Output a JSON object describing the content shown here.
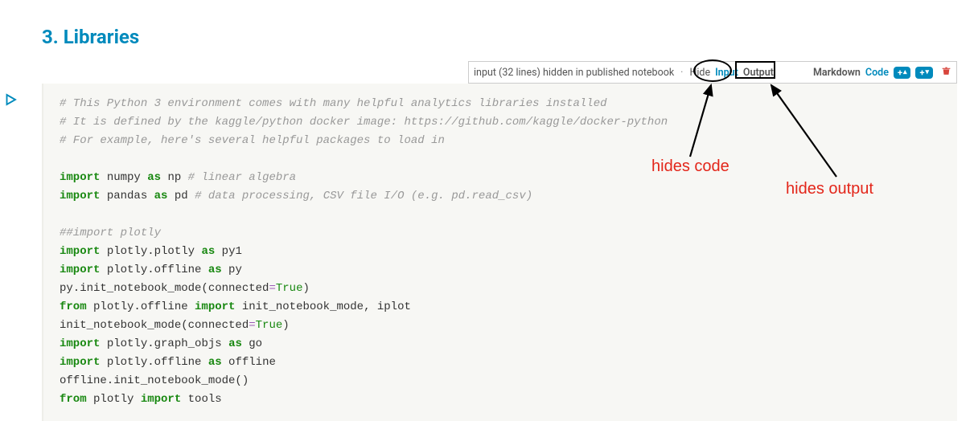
{
  "heading": "3. Libraries",
  "toolbar": {
    "status": "input (32 lines) hidden in published notebook",
    "hide_label": "Hide",
    "input_label": "Input",
    "output_label": "Output",
    "markdown_label": "Markdown",
    "code_label": "Code",
    "add_above": "+",
    "add_below": "+"
  },
  "annotations": {
    "hides_code": "hides code",
    "hides_output": "hides output"
  },
  "code": {
    "l1": "# This Python 3 environment comes with many helpful analytics libraries installed",
    "l2": "# It is defined by the kaggle/python docker image: https://github.com/kaggle/docker-python",
    "l3": "# For example, here's several helpful packages to load in",
    "l4_kw1": "import",
    "l4_txt1": " numpy ",
    "l4_kw2": "as",
    "l4_txt2": " np ",
    "l4_cm": "# linear algebra",
    "l5_kw1": "import",
    "l5_txt1": " pandas ",
    "l5_kw2": "as",
    "l5_txt2": " pd ",
    "l5_cm": "# data processing, CSV file I/O (e.g. pd.read_csv)",
    "l6": "##import plotly",
    "l7_kw1": "import",
    "l7_txt1": " plotly.plotly ",
    "l7_kw2": "as",
    "l7_txt2": " py1",
    "l8_kw1": "import",
    "l8_txt1": " plotly.offline ",
    "l8_kw2": "as",
    "l8_txt2": " py",
    "l9_a": "py.init_notebook_mode(connected",
    "l9_op": "=",
    "l9_val": "True",
    "l9_b": ")",
    "l10_kw1": "from",
    "l10_txt1": " plotly.offline ",
    "l10_kw2": "import",
    "l10_txt2": " init_notebook_mode, iplot",
    "l11_a": "init_notebook_mode(connected",
    "l11_op": "=",
    "l11_val": "True",
    "l11_b": ")",
    "l12_kw1": "import",
    "l12_txt1": " plotly.graph_objs ",
    "l12_kw2": "as",
    "l12_txt2": " go",
    "l13_kw1": "import",
    "l13_txt1": " plotly.offline ",
    "l13_kw2": "as",
    "l13_txt2": " offline",
    "l14": "offline.init_notebook_mode()",
    "l15_kw1": "from",
    "l15_txt1": " plotly ",
    "l15_kw2": "import",
    "l15_txt2": " tools"
  }
}
